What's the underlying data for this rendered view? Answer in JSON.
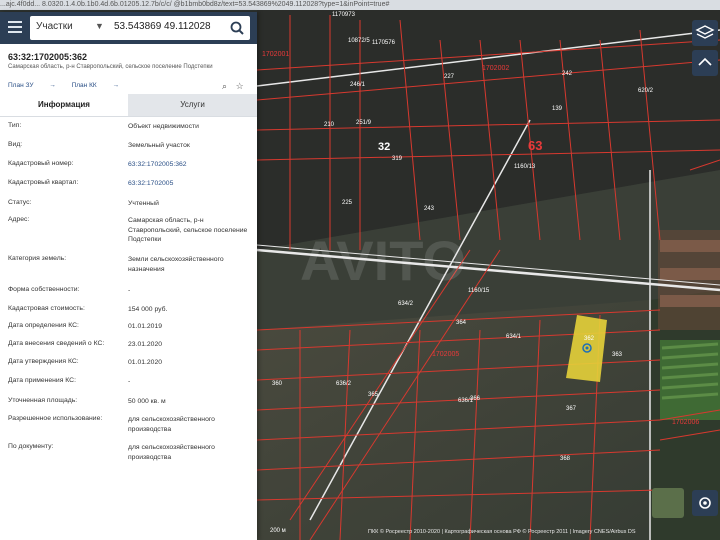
{
  "browser": {
    "url": "...ajc.4f0dd... 8.0320.1.4.0b.1b0.4d.6b.01205.12.7b/c/c/ @b1bmb0bd8z/text=53.543869%2049.112028?type=1&inPoint=true#"
  },
  "search": {
    "layer": "Участки",
    "query": "53.543869 49.112028"
  },
  "parcel": {
    "number": "63:32:1702005:362",
    "address_short": "Самарская область, р-н Ставропольский, сельское поселение Подстепки",
    "plan_zu": "План ЗУ",
    "plan_kk": "План КК"
  },
  "tabs": {
    "info": "Информация",
    "services": "Услуги"
  },
  "fields": [
    {
      "label": "Тип:",
      "value": "Объект недвижимости"
    },
    {
      "label": "Вид:",
      "value": "Земельный участок"
    },
    {
      "label": "Кадастровый номер:",
      "value": "63:32:1702005:362"
    },
    {
      "label": "Кадастровый квартал:",
      "value": "63:32:1702005"
    },
    {
      "label": "Статус:",
      "value": "Учтенный"
    },
    {
      "label": "Адрес:",
      "value": "Самарская область, р-н Ставропольский, сельское поселение Подстепки"
    },
    {
      "label": "Категория земель:",
      "value": "Земли сельскохозяйственного назначения"
    },
    {
      "label": "Форма собственности:",
      "value": "-"
    },
    {
      "label": "Кадастровая стоимость:",
      "value": "154 000 руб."
    },
    {
      "label": "Дата определения КС:",
      "value": "01.01.2019"
    },
    {
      "label": "Дата внесения сведений о КС:",
      "value": "23.01.2020"
    },
    {
      "label": "Дата утверждения КС:",
      "value": "01.01.2020"
    },
    {
      "label": "Дата применения КС:",
      "value": "-"
    },
    {
      "label": "Уточненная площадь:",
      "value": "50 000 кв. м"
    },
    {
      "label": "Разрешенное использование:",
      "value": "для сельскохозяйственного производства"
    },
    {
      "label": "По документу:",
      "value": "для сельскохозяйственного производства"
    }
  ],
  "map": {
    "labels": [
      "1702001",
      "1702002",
      "1702005",
      "1702006",
      "63",
      "32",
      "362",
      "363",
      "364",
      "365",
      "366",
      "367",
      "368",
      "360",
      "634/1",
      "634/2",
      "636/1",
      "636/2",
      "1170973",
      "10872/5",
      "1170576",
      "246/1",
      "227",
      "225",
      "210",
      "251/9",
      "243",
      "242",
      "139",
      "319",
      "1160/15",
      "1160/13",
      "620/2"
    ],
    "scale": "200 м",
    "footer": "ПКК © Росреестр 2010-2020 | Картографическая основа РФ © Росреестр 2011 | Imagery CNES/Airbus DS",
    "highlight_color": "#e5d13a",
    "boundary_color": "#d7392f"
  }
}
